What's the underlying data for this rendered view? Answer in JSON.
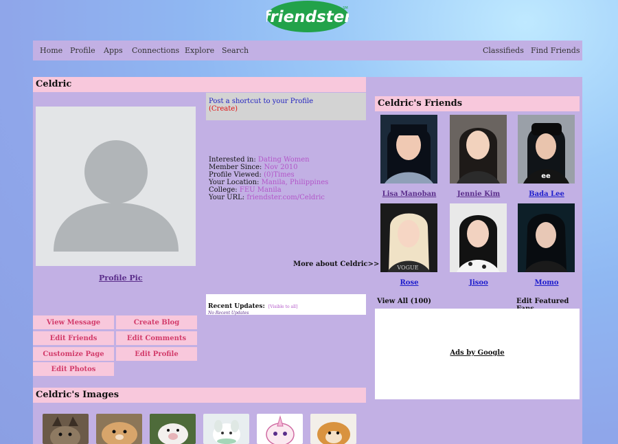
{
  "brand": {
    "logo_text": "friendster",
    "logo_color": "#22a24a"
  },
  "nav": {
    "left": [
      "Home",
      "Profile",
      "Apps",
      "Connections",
      "Explore",
      "Search"
    ],
    "right": [
      "Classifieds",
      "Find Friends"
    ]
  },
  "profile": {
    "name": "Celdric",
    "pic_link": "Profile Pic",
    "shortcut_text": "Post a shortcut to your Profile",
    "shortcut_create": "(Create)",
    "fields": [
      {
        "label": "Interested in:",
        "value": "Dating Women"
      },
      {
        "label": "Member Since:",
        "value": "Nov 2010"
      },
      {
        "label": "Profile Viewed:",
        "value": "(0)Times"
      },
      {
        "label": "Your Location:",
        "value": "Manila, Philippines"
      },
      {
        "label": "College:",
        "value": "FEU Manila"
      },
      {
        "label": "Your URL:",
        "value": "friendster.com/Celdric"
      }
    ],
    "more_about": "More about Celdric>>",
    "recent_updates": {
      "title": "Recent Updates:",
      "scope": "[Visible to all]",
      "empty": "No Recent Updates"
    }
  },
  "actions": [
    "View Message",
    "Create Blog",
    "Edit Friends",
    "Edit Comments",
    "Customize Page",
    "Edit Profile",
    "Edit Photos"
  ],
  "images_section": {
    "title": "Celdric's Images",
    "items": [
      "cat",
      "hamster",
      "piglet",
      "bunny",
      "unicorn",
      "pomeranian"
    ]
  },
  "friends_section": {
    "title": "Celdric's Friends",
    "friends": [
      {
        "name": "Lisa Manoban",
        "link_color": "#5a2d8a"
      },
      {
        "name": "Jennie Kim",
        "link_color": "#5a2d8a"
      },
      {
        "name": "Bada Lee",
        "link_color": "#1c1ccc"
      },
      {
        "name": "Rose",
        "link_color": "#1c1ccc"
      },
      {
        "name": "Jisoo",
        "link_color": "#1c1ccc"
      },
      {
        "name": "Momo",
        "link_color": "#1c1ccc"
      }
    ],
    "view_all": "View All (100)",
    "edit_featured": "Edit Featured Fans"
  },
  "ads": {
    "label": "Ads by Google"
  }
}
